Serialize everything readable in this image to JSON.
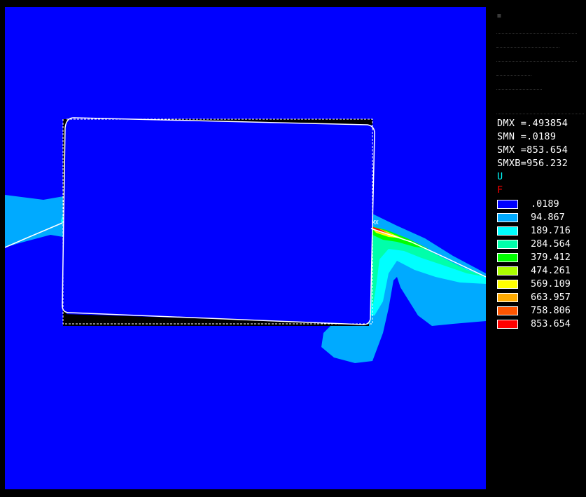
{
  "legend": {
    "stats": [
      {
        "label": "DMX =.493854"
      },
      {
        "label": "SMN =.0189"
      },
      {
        "label": "SMX =853.654"
      },
      {
        "label": "SMXB=956.232"
      }
    ],
    "markers": {
      "u": "U",
      "f": "F"
    },
    "plot_annotation": "MX",
    "contour_levels": [
      {
        "value": ".0189",
        "color": "#0000ff"
      },
      {
        "value": "94.867",
        "color": "#00aaff"
      },
      {
        "value": "189.716",
        "color": "#00ffff"
      },
      {
        "value": "284.564",
        "color": "#00ffaa"
      },
      {
        "value": "379.412",
        "color": "#00ff00"
      },
      {
        "value": "474.261",
        "color": "#aaff00"
      },
      {
        "value": "569.109",
        "color": "#ffff00"
      },
      {
        "value": "663.957",
        "color": "#ffaa00"
      },
      {
        "value": "758.806",
        "color": "#ff5500"
      },
      {
        "value": "853.654",
        "color": "#ff0000"
      }
    ],
    "marker_colors": {
      "u": "#00ffff",
      "f": "#ff0000"
    }
  }
}
